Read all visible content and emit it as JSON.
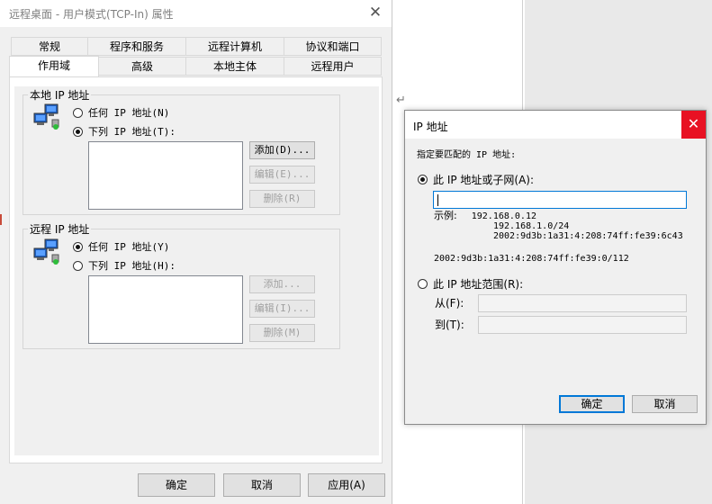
{
  "main_window": {
    "title": "远程桌面 - 用户模式(TCP-In) 属性",
    "close_glyph": "✕",
    "tabs_row1": [
      "常规",
      "程序和服务",
      "远程计算机",
      "协议和端口"
    ],
    "tabs_row2": [
      "作用域",
      "高级",
      "本地主体",
      "远程用户"
    ],
    "local_ip": {
      "title": "本地 IP 地址",
      "option_any": "任何 IP 地址(N)",
      "option_list": "下列 IP 地址(T):",
      "selected": "list",
      "add": "添加(D)...",
      "edit": "编辑(E)...",
      "remove": "删除(R)"
    },
    "remote_ip": {
      "title": "远程 IP 地址",
      "option_any": "任何 IP 地址(Y)",
      "option_list": "下列 IP 地址(H):",
      "selected": "any",
      "add": "添加...",
      "edit": "编辑(I)...",
      "remove": "删除(M)"
    },
    "footer": {
      "ok": "确定",
      "cancel": "取消",
      "apply": "应用(A)"
    }
  },
  "ip_dialog": {
    "title": "IP 地址",
    "close_glyph": "✕",
    "prompt": "指定要匹配的 IP 地址:",
    "option_subnet": "此 IP 地址或子网(A):",
    "subnet_value": "",
    "examples_label": "示例:",
    "examples": [
      "192.168.0.12",
      "192.168.1.0/24",
      "2002:9d3b:1a31:4:208:74ff:fe39:6c43",
      "2002:9d3b:1a31:4:208:74ff:fe39:0/112"
    ],
    "option_range": "此 IP 地址范围(R):",
    "from_label": "从(F):",
    "to_label": "到(T):",
    "from_value": "",
    "to_value": "",
    "selected": "subnet",
    "ok": "确定",
    "cancel": "取消"
  },
  "document": {
    "paragraph_mark": "↵"
  },
  "colors": {
    "accent": "#0078d7",
    "close_red": "#e81123"
  }
}
